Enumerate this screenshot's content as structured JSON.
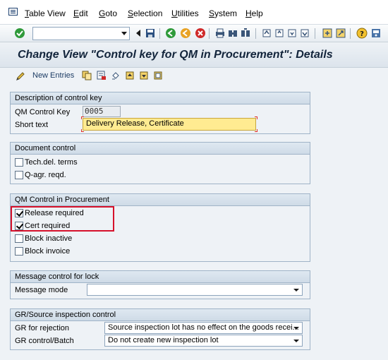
{
  "menu": {
    "items": [
      {
        "label": "Table View",
        "u": "T",
        "rest": "able View"
      },
      {
        "label": "Edit",
        "u": "E",
        "rest": "dit"
      },
      {
        "label": "Goto",
        "u": "G",
        "rest": "oto"
      },
      {
        "label": "Selection",
        "u": "S",
        "rest": "election"
      },
      {
        "label": "Utilities",
        "u": "U",
        "rest": "tilities"
      },
      {
        "label": "System",
        "u": "S",
        "rest": "ystem"
      },
      {
        "label": "Help",
        "u": "H",
        "rest": "elp"
      }
    ]
  },
  "command_field": {
    "value": ""
  },
  "title": "Change View \"Control key for QM in Procurement\": Details",
  "app_toolbar": {
    "new_entries": "New Entries"
  },
  "groups": {
    "description": {
      "title": "Description of control key",
      "qm_control_key_label": "QM Control Key",
      "qm_control_key_value": "0005",
      "short_text_label": "Short text",
      "short_text_value": "Delivery Release, Certificate"
    },
    "document_control": {
      "title": "Document control",
      "tech_del_terms": "Tech.del. terms",
      "q_agr_reqd": "Q-agr. reqd."
    },
    "qm_control": {
      "title": "QM Control in Procurement",
      "release_required": "Release required",
      "cert_required": "Cert required",
      "block_inactive": "Block inactive",
      "block_invoice": "Block invoice"
    },
    "message_control": {
      "title": "Message control for lock",
      "message_mode_label": "Message mode",
      "message_mode_value": ""
    },
    "gr_control": {
      "title": "GR/Source inspection control",
      "gr_rejection_label": "GR for rejection",
      "gr_rejection_value": "Source inspection lot has no effect on the goods recei...",
      "gr_batch_label": "GR control/Batch",
      "gr_batch_value": "Do not create new inspection lot"
    }
  },
  "checkbox_states": {
    "tech_del_terms": false,
    "q_agr_reqd": false,
    "release_required": true,
    "cert_required": true,
    "block_inactive": false,
    "block_invoice": false
  },
  "colors": {
    "highlight_border": "#d6112b",
    "active_field": "#ffeb91",
    "title_text": "#12243b"
  }
}
